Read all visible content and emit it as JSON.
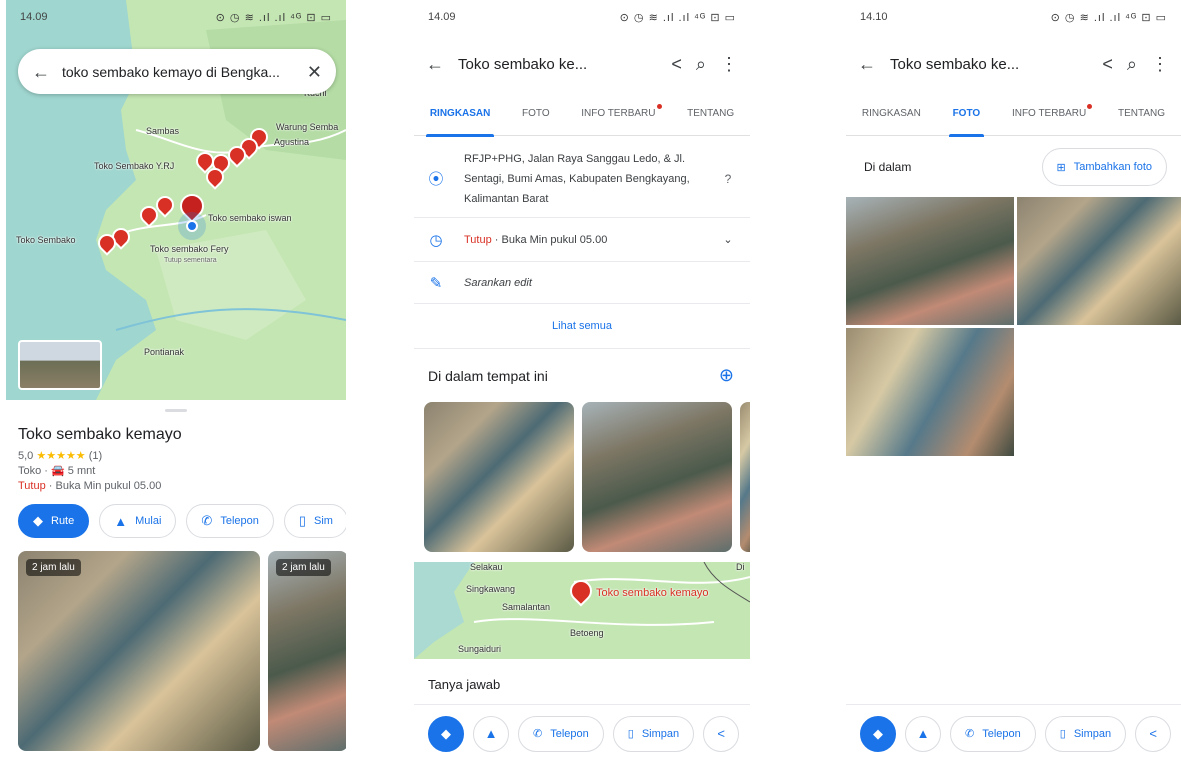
{
  "status": {
    "time1": "14.09",
    "time2": "14.09",
    "time3": "14.10",
    "icons": "⊙ ◷ ≋ .ıl .ıl ⁴ᴳ ⊡ ▭"
  },
  "screen1": {
    "search_text": "toko sembako kemayo di Bengka...",
    "map_labels": {
      "kuching": "Kuchi",
      "sambas": "Sambas",
      "warung": "Warung Semba",
      "agustina": "Agustina",
      "yrj": "Toko Sembako Y.RJ",
      "iswan": "Toko sembako iswan",
      "toko_left": "Toko Sembako",
      "fery": "Toko sembako Fery",
      "fery_status": "Tutup sementara",
      "pontianak": "Pontianak"
    },
    "place": {
      "name": "Toko sembako kemayo",
      "rating": "5,0",
      "stars": "★★★★★",
      "reviews": "(1)",
      "category": "Toko ·",
      "drive": "5 mnt",
      "closed": "Tutup",
      "hours": "· Buka Min pukul 05.00"
    },
    "chips": {
      "route": "Rute",
      "start": "Mulai",
      "call": "Telepon",
      "save": "Sim"
    },
    "photo_badges": [
      "2 jam lalu",
      "2 jam lalu"
    ]
  },
  "screen2": {
    "title": "Toko sembako ke...",
    "tabs": [
      "RINGKASAN",
      "FOTO",
      "INFO TERBARU",
      "TENTANG"
    ],
    "address": "RFJP+PHG, Jalan Raya Sanggau Ledo, & Jl. Sentagi, Bumi Amas, Kabupaten Bengkayang, Kalimantan Barat",
    "closed": "Tutup",
    "hours": "· Buka Min pukul 05.00",
    "suggest_edit": "Sarankan edit",
    "see_all": "Lihat semua",
    "inside_title": "Di dalam tempat ini",
    "map_labels": {
      "top": "Selakau",
      "singkawang": "Singkawang",
      "samalantan": "Samalantan",
      "pin_label": "Toko sembako kemayo",
      "betoeng": "Betoeng",
      "sungaiduri": "Sungaiduri",
      "edge": "Di"
    },
    "qa": "Tanya jawab",
    "bottom": {
      "call": "Telepon",
      "save": "Simpan"
    }
  },
  "screen3": {
    "title": "Toko sembako ke...",
    "tabs": [
      "RINGKASAN",
      "FOTO",
      "INFO TERBARU",
      "TENTANG"
    ],
    "section": "Di dalam",
    "add_photo": "Tambahkan foto",
    "bottom": {
      "call": "Telepon",
      "save": "Simpan"
    }
  },
  "colors": {
    "accent": "#1a73e8",
    "closed": "#d93025",
    "pin": "#d93025",
    "star": "#fbbc04"
  }
}
